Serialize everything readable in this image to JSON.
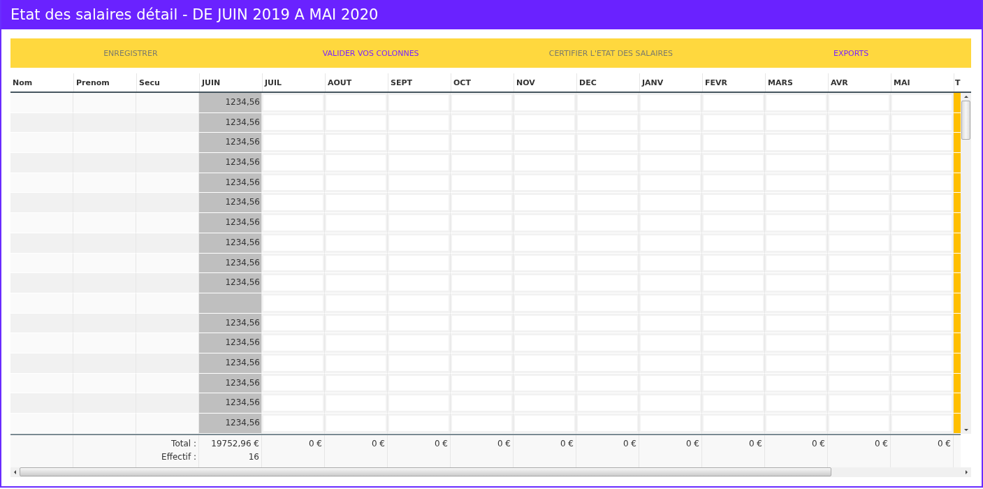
{
  "window": {
    "title": "Etat des salaires détail - DE JUIN 2019 A MAI 2020"
  },
  "toolbar": [
    {
      "label": "ENREGISTRER",
      "disabled": true
    },
    {
      "label": "VALIDER VOS COLONNES",
      "disabled": false
    },
    {
      "label": "CERTIFIER L'ETAT DES SALAIRES",
      "disabled": true
    },
    {
      "label": "EXPORTS",
      "disabled": false
    }
  ],
  "table": {
    "columns": [
      {
        "label": "Nom",
        "kind": "text"
      },
      {
        "label": "Prenom",
        "kind": "text"
      },
      {
        "label": "Secu",
        "kind": "text"
      },
      {
        "label": "JUIN",
        "kind": "readonly"
      },
      {
        "label": "JUIL",
        "kind": "input"
      },
      {
        "label": "AOUT",
        "kind": "input"
      },
      {
        "label": "SEPT",
        "kind": "input"
      },
      {
        "label": "OCT",
        "kind": "input"
      },
      {
        "label": "NOV",
        "kind": "input"
      },
      {
        "label": "DEC",
        "kind": "input"
      },
      {
        "label": "JANV",
        "kind": "input"
      },
      {
        "label": "FEVR",
        "kind": "input"
      },
      {
        "label": "MARS",
        "kind": "input"
      },
      {
        "label": "AVR",
        "kind": "input"
      },
      {
        "label": "MAI",
        "kind": "input"
      },
      {
        "label": "T",
        "kind": "flag"
      }
    ],
    "rows": [
      {
        "juin": "1234,56"
      },
      {
        "juin": "1234,56"
      },
      {
        "juin": "1234,56"
      },
      {
        "juin": "1234,56"
      },
      {
        "juin": "1234,56"
      },
      {
        "juin": "1234,56"
      },
      {
        "juin": "1234,56"
      },
      {
        "juin": "1234,56"
      },
      {
        "juin": "1234,56"
      },
      {
        "juin": "1234,56"
      },
      {},
      {
        "juin": "1234,56"
      },
      {
        "juin": "1234,56"
      },
      {
        "juin": "1234,56"
      },
      {
        "juin": "1234,56"
      },
      {
        "juin": "1234,56"
      },
      {
        "juin": "1234,56"
      }
    ],
    "footer": {
      "total_label": "Total :",
      "effectif_label": "Effectif :",
      "totals": [
        "19752,96 €",
        "0 €",
        "0 €",
        "0 €",
        "0 €",
        "0 €",
        "0 €",
        "0 €",
        "0 €",
        "0 €",
        "0 €",
        "0 €"
      ],
      "effectif": "16"
    }
  }
}
